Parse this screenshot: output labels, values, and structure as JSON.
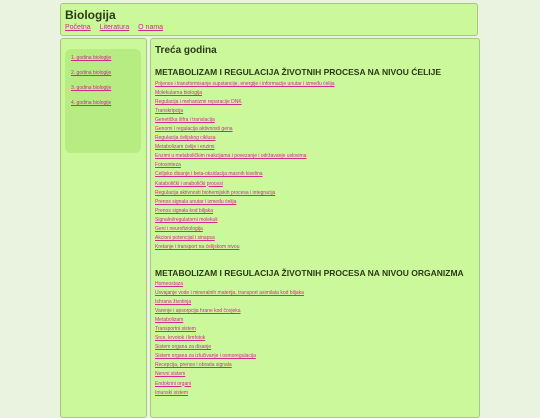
{
  "site": {
    "title": "Biologija",
    "nav": [
      "Početna",
      "Literatura",
      "O nama"
    ]
  },
  "sidebar": {
    "items": [
      "1. godina biologije",
      "2. godina biologije",
      "3. godina biologije",
      "4. godina biologije"
    ]
  },
  "main": {
    "title": "Treća godina",
    "sections": [
      {
        "heading": "METABOLIZAM I REGULACIJA ŽIVOTNIH PROCESA NA NIVOU ĆELIJE",
        "links": [
          "Prijenos i transformisanje supstancije, energije i informacije unutar i između ćelija",
          "Molekularna biologija",
          "Regulacija i mehanizmi reparacije DNK",
          "Transkripcija",
          "Genetička šifra i translacija",
          "Genomi i regulacija aktivnosti gena",
          "Regulacija ćelijskog ciklusa",
          "Metabolizam ćelije i enzimi",
          "Enzimi u metaboličkim reakcijama i povezanje i održavanje uslovima",
          "Fotosinteza",
          "Ćelijsko disanje i beta-oksidacija masnih kiselina",
          "Katabolički i anabolički procesi",
          "Regulacija aktivnosti biohemijskih procesa i integracija",
          "Prenos signala unutar i između ćelija",
          "Prenos signala kod biljaka",
          "Signalni/regulatorni molekuli",
          "Geni i neurofiziologija",
          "Akcioni potencijal i sinapsa",
          "Kretanje i transport na ćelijskom nivou"
        ]
      },
      {
        "heading": "METABOLIZAM I REGULACIJA ŽIVOTNIH PROCESA NA NIVOU ORGANIZMA",
        "links": [
          "Homeostaza",
          "Usvajanje vode i mineralnih materija, transport asimilata kod biljaka",
          "Ishrana životinja",
          "Varenje i apsorpcija hrane kod čovjeka",
          "Metabolizam",
          "Transportni sistem",
          "Srce, krvotok i limfotok",
          "Sistem organa za disanje",
          "Sistem organa za izlučivanje i osmoregulacija",
          "Recepcija, prenos i obrada signala",
          "Nervni sistem",
          "Endokrini organi",
          "Imunski sistem"
        ]
      }
    ]
  }
}
